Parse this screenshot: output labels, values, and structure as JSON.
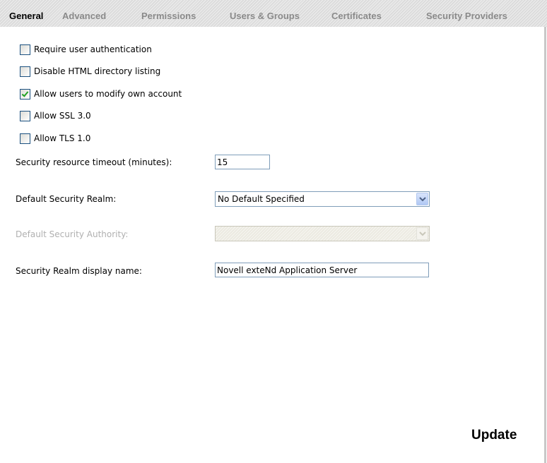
{
  "tabs": [
    {
      "label": "General",
      "active": true
    },
    {
      "label": "Advanced",
      "active": false
    },
    {
      "label": "Permissions",
      "active": false
    },
    {
      "label": "Users & Groups",
      "active": false
    },
    {
      "label": "Certificates",
      "active": false
    },
    {
      "label": "Security Providers",
      "active": false
    }
  ],
  "options": [
    {
      "label": "Require user authentication",
      "checked": false
    },
    {
      "label": "Disable HTML directory listing",
      "checked": false
    },
    {
      "label": "Allow users to modify own account",
      "checked": true
    },
    {
      "label": "Allow SSL 3.0",
      "checked": false
    },
    {
      "label": "Allow TLS 1.0",
      "checked": false
    }
  ],
  "fields": {
    "timeout": {
      "label": "Security resource timeout (minutes):",
      "value": "15"
    },
    "realm": {
      "label": "Default Security Realm:",
      "value": "No Default Specified"
    },
    "authority": {
      "label": "Default Security Authority:",
      "value": "",
      "disabled": true
    },
    "display_name": {
      "label": "Security Realm display name:",
      "value": "Novell exteNd Application Server"
    }
  },
  "actions": {
    "update_label": "Update"
  },
  "colors": {
    "active_tab": "#000000",
    "inactive_tab": "#8a8a8a",
    "checkmark": "#21a121",
    "input_border": "#7f9db9",
    "disabled_text": "#b0b0b0"
  }
}
